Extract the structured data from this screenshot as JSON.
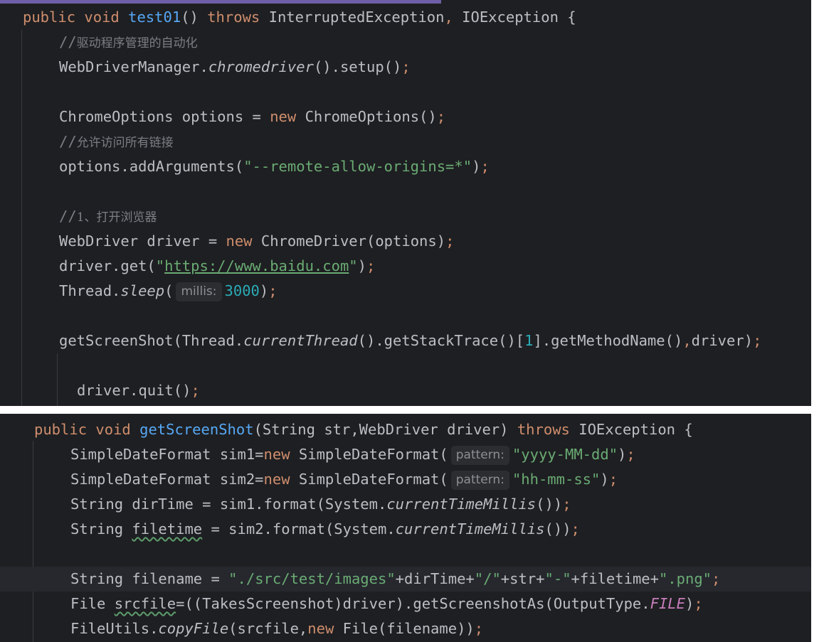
{
  "editor": {
    "colors": {
      "background": "#1e1f22",
      "keyword": "#cf8e6d",
      "method_declaration": "#56a8f5",
      "string": "#6aab73",
      "number": "#2aacb8",
      "comment": "#7a7e85",
      "constant": "#c77dbb",
      "default_text": "#bcbec4",
      "inlay_hint_bg": "#2b2d30"
    },
    "test01": {
      "signature": {
        "kw_public": "public",
        "kw_void": "void",
        "name": "test01",
        "parens": "() ",
        "kw_throws": "throws",
        "ex1": " InterruptedException",
        "comma": ",",
        "ex2": " IOException {"
      },
      "comment_driver_slash": "//",
      "comment_driver_text": "驱动程序管理的自动化",
      "wdm_class": "WebDriverManager.",
      "wdm_method": "chromedriver",
      "wdm_rest": "().setup()",
      "semi": ";",
      "options_type": "ChromeOptions options = ",
      "kw_new": "new",
      "options_ctor": " ChromeOptions()",
      "comment_allow_slash": "//",
      "comment_allow_text": "允许访问所有链接",
      "addargs_call": "options.addArguments(",
      "addargs_string": "\"--remote-allow-origins=*\"",
      "close_paren": ")",
      "comment_open_slash": "//",
      "comment_open_text": "1、打开浏览器",
      "driver_decl": "WebDriver driver = ",
      "driver_ctor": " ChromeDriver(options)",
      "get_call": "driver.get(",
      "quote": "\"",
      "url": "https://www.baidu.com",
      "sleep_class": "Thread.",
      "sleep_method": "sleep",
      "open_paren": "(",
      "sleep_hint": "millis:",
      "sleep_value": "3000",
      "screenshot_call": "getScreenShot(Thread.",
      "current_thread": "currentThread",
      "stack_trace": "().getStackTrace()[",
      "index": "1",
      "method_name": "].getMethodName()",
      "comma": ",",
      "driver_arg": "driver)",
      "quit_call": "driver.quit()"
    },
    "getScreenShot": {
      "signature": {
        "kw_public": "public",
        "kw_void": "void",
        "name": "getScreenShot",
        "params": "(String str,WebDriver driver) ",
        "kw_throws": "throws",
        "ex": " IOException {"
      },
      "sim1_decl": "SimpleDateFormat sim1=",
      "kw_new": "new",
      "sdf_ctor": " SimpleDateFormat(",
      "pattern_hint": "pattern:",
      "pattern1": "\"yyyy-MM-dd\"",
      "sim2_decl": "SimpleDateFormat sim2=",
      "pattern2": "\"hh-mm-ss\"",
      "close_paren": ")",
      "semi": ";",
      "dirtime_decl": "String dirTime = sim1.format(System.",
      "ctm": "currentTimeMillis",
      "ctm_close": "())",
      "filetime_type": "String ",
      "filetime_var": "filetime",
      "filetime_rest": " = sim2.format(System.",
      "filename_decl": "String filename = ",
      "path_str": "\"./src/test/images\"",
      "plus_dirtime": "+dirTime+",
      "slash_str": "\"/\"",
      "plus_str": "+str+",
      "dash_str": "\"-\"",
      "plus_filetime": "+filetime+",
      "png_str": "\".png\"",
      "file_type": "File ",
      "srcfile_var": "srcfile",
      "srcfile_rest": "=((TakesScreenshot)driver).getScreenshotAs(OutputType.",
      "file_const": "FILE",
      "copy_class": "FileUtils.",
      "copy_method": "copyFile",
      "copy_args": "(srcfile,",
      "copy_ctor": " File(filename))"
    }
  }
}
